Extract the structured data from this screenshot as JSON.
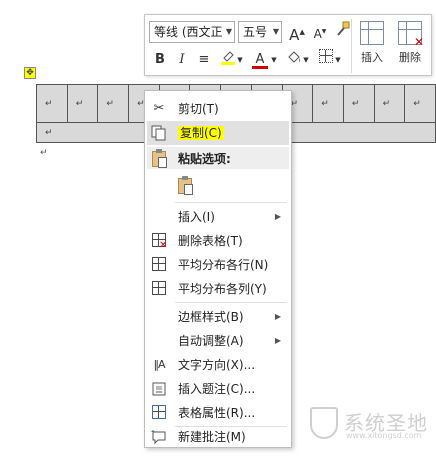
{
  "toolbar": {
    "font_name": "等线 (西文正",
    "font_size": "五号",
    "grow_font": "A",
    "shrink_font": "A",
    "bold": "B",
    "italic": "I",
    "center": "≡",
    "font_color": "A",
    "insert_label": "插入",
    "delete_label": "删除"
  },
  "document": {
    "cell_mark": "↵",
    "after_table_mark": "↵",
    "row1_cells": [
      "↵",
      "↵",
      "↵",
      "↵",
      "↵",
      "↵",
      "↵",
      "↵",
      "↵",
      "↵",
      "↵",
      "↵",
      "↵"
    ],
    "row2_cell": "↵",
    "table_handle": "✥"
  },
  "context_menu": {
    "cut": "剪切(T)",
    "copy": "复制(C)",
    "paste_header": "粘贴选项:",
    "insert": "插入(I)",
    "delete_table": "删除表格(T)",
    "distribute_rows": "平均分布各行(N)",
    "distribute_cols": "平均分布各列(Y)",
    "border_styles": "边框样式(B)",
    "autofit": "自动调整(A)",
    "text_direction": "文字方向(X)...",
    "insert_caption": "插入题注(C)...",
    "table_properties": "表格属性(R)...",
    "new_comment": "新建批注(M)"
  },
  "watermark": {
    "text": "系统圣地",
    "sub": "www.xitongsd.com"
  },
  "colors": {
    "highlight_yellow": "#ffff00",
    "font_color_red": "#d40000",
    "hover_gray": "#e1e1e1",
    "table_fill": "#d9d9d9"
  }
}
